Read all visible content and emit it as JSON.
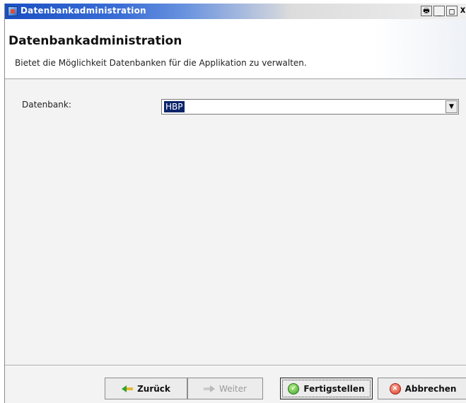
{
  "window": {
    "title": "Datenbankadministration",
    "print_glyph": "🖶",
    "min_glyph": "_",
    "max_glyph": "□",
    "close_glyph": "x"
  },
  "header": {
    "title": "Datenbankadministration",
    "description": "Bietet die Möglichkeit Datenbanken für die Applikation zu verwalten."
  },
  "form": {
    "database_label": "Datenbank:",
    "database_value": "HBP",
    "dropdown_arrow": "▼"
  },
  "footer": {
    "back_label": "Zurück",
    "next_label": "Weiter",
    "finish_label": "Fertigstellen",
    "cancel_label": "Abbrechen",
    "check_glyph": "✓",
    "cancel_glyph": "×"
  }
}
